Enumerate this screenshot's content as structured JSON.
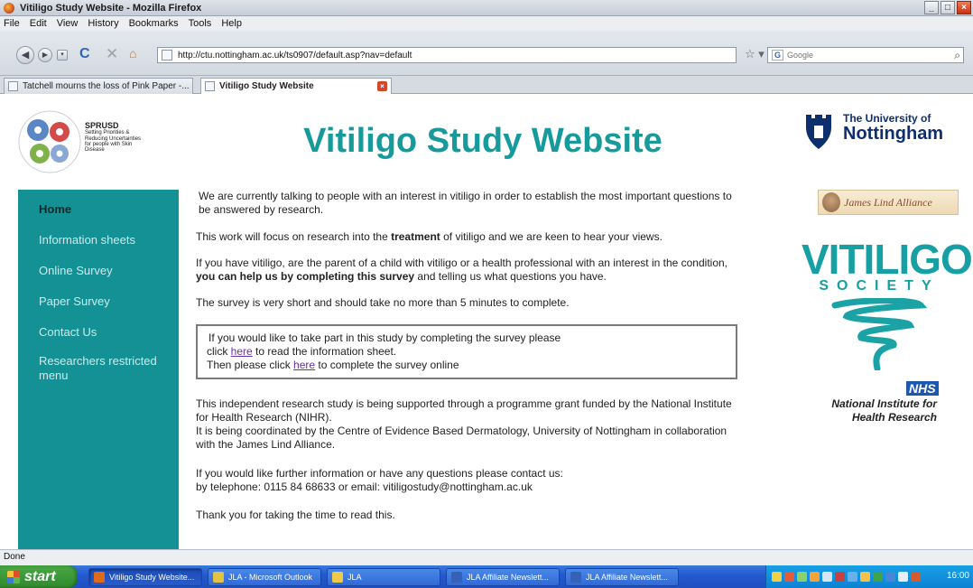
{
  "window": {
    "title": "Vitiligo Study Website - Mozilla Firefox",
    "buttons": {
      "minimize": "_",
      "maximize": "□",
      "close": "×"
    }
  },
  "menu": [
    "File",
    "Edit",
    "View",
    "History",
    "Bookmarks",
    "Tools",
    "Help"
  ],
  "navbar": {
    "url": "http://ctu.nottingham.ac.uk/ts0907/default.asp?nav=default",
    "search_placeholder": "Google",
    "search_engine_label": "G"
  },
  "tabs": [
    {
      "label": "Tatchell mourns the loss of Pink Paper -..."
    },
    {
      "label": "Vitiligo Study Website"
    }
  ],
  "header": {
    "sprusd_title": "SPRUSD",
    "sprusd_lines": [
      "Setting Priorities &",
      "Reducing Uncertainties",
      "for people with Skin",
      "Disease"
    ],
    "site_title": "Vitiligo Study Website",
    "uon_line1": "The University of",
    "uon_line2": "Nottingham"
  },
  "sidebar": {
    "items": [
      {
        "label": "Home"
      },
      {
        "label": "Information sheets"
      },
      {
        "label": "Online Survey"
      },
      {
        "label": "Paper Survey"
      },
      {
        "label": "Contact Us"
      },
      {
        "label": "Researchers restricted menu"
      }
    ]
  },
  "content": {
    "p1": "We are currently talking to people with an interest in vitiligo in order to establish the most important questions to be answered by research.",
    "p2_a": "This work will focus on research into the ",
    "p2_b": "treatment",
    "p2_c": " of vitiligo and we are keen to hear your views.",
    "p3_a": "If you have vitiligo, are the parent of a child with vitiligo or a health professional with an interest in the condition, ",
    "p3_b": "you can help us by completing this survey",
    "p3_c": " and telling us what questions you have.",
    "p4": "The survey is very short and should take no more than 5 minutes to complete.",
    "callout_l1": "If you would like to take part in this study by completing the survey please",
    "callout_l2_a": "click ",
    "callout_l2_link": "here",
    "callout_l2_b": " to read the information sheet.",
    "callout_l3_a": "Then please click ",
    "callout_l3_link": "here",
    "callout_l3_b": " to complete the survey online",
    "p5_l1": "This independent research study is being supported through a programme grant funded by the National Institute for Health Research (NIHR).",
    "p5_l2": "It is being coordinated by the Centre of Evidence Based Dermatology, University of Nottingham in collaboration with the James Lind Alliance.",
    "p6_l1": "If you would like further information or have any questions please contact us:",
    "p6_l2": "by telephone: 0115 84 68633 or email: vitiligostudy@nottingham.ac.uk",
    "p7": "Thank you for taking the time to read this."
  },
  "right": {
    "jla": "James Lind Alliance",
    "vs_title": "VITILIGO",
    "vs_society": "SOCIETY",
    "nhs": "NHS",
    "nihr_l1": "National Institute for",
    "nihr_l2": "Health Research"
  },
  "status": "Done",
  "taskbar": {
    "start": "start",
    "tasks": [
      {
        "label": "Vitiligo Study Website...",
        "icon_color": "#e06a1c"
      },
      {
        "label": "JLA - Microsoft Outlook",
        "icon_color": "#e2c342"
      },
      {
        "label": "JLA",
        "icon_color": "#f0c84a"
      },
      {
        "label": "JLA Affiliate Newslett...",
        "icon_color": "#3561b8"
      },
      {
        "label": "JLA Affiliate Newslett...",
        "icon_color": "#3561b8"
      }
    ],
    "clock": "16:00"
  }
}
